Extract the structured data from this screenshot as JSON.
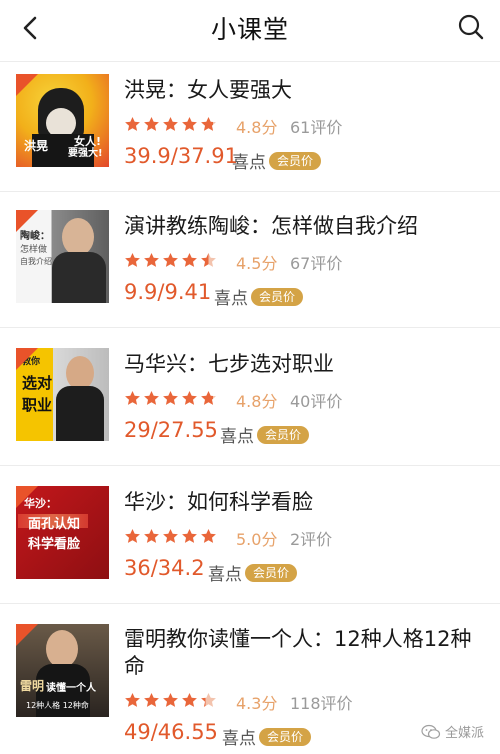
{
  "header": {
    "title": "小课堂",
    "back_icon": "chevron-left-icon",
    "search_icon": "search-icon"
  },
  "courses": [
    {
      "title": "洪晃：女人要强大",
      "rating": 4.8,
      "score_text": "4.8分",
      "reviews_text": "61评价",
      "price_text": "39.9/37.91",
      "xidian_label": "喜点",
      "vip_label": "会员价",
      "cover_label_1": "女人!",
      "cover_label_2": "要强大!",
      "cover_name": "洪晃",
      "cover_colors": [
        "#f2c21a",
        "#e3472b"
      ]
    },
    {
      "title": "演讲教练陶峻：怎样做自我介绍",
      "rating": 4.5,
      "score_text": "4.5分",
      "reviews_text": "67评价",
      "price_text": "9.9/9.41",
      "xidian_label": "喜点",
      "vip_label": "会员价",
      "cover_label_1": "陶峻：",
      "cover_label_2": "怎样做",
      "cover_label_3": "自我介绍",
      "cover_colors": [
        "#efefef",
        "#6b6b6b"
      ]
    },
    {
      "title": "马华兴：七步选对职业",
      "rating": 4.8,
      "score_text": "4.8分",
      "reviews_text": "40评价",
      "price_text": "29/27.55",
      "xidian_label": "喜点",
      "vip_label": "会员价",
      "cover_label_1": "教你",
      "cover_label_2": "选对",
      "cover_label_3": "职业",
      "cover_colors": [
        "#f5c400",
        "#1e1e1e"
      ]
    },
    {
      "title": "华沙：如何科学看脸",
      "rating": 5.0,
      "score_text": "5.0分",
      "reviews_text": "2评价",
      "price_text": "36/34.2",
      "xidian_label": "喜点",
      "vip_label": "会员价",
      "cover_label_1": "华沙：",
      "cover_label_2": "面孔认知",
      "cover_label_3": "科学看脸",
      "cover_colors": [
        "#b0181b",
        "#6e0c0e"
      ]
    },
    {
      "title": "雷明教你读懂一个人：12种人格12种命",
      "rating": 4.3,
      "score_text": "4.3分",
      "reviews_text": "118评价",
      "price_text": "49/46.55",
      "xidian_label": "喜点",
      "vip_label": "会员价",
      "cover_label_1": "雷明",
      "cover_label_2": "读懂一个人",
      "cover_label_3": "12种人格 12种命",
      "cover_colors": [
        "#5a4a3a",
        "#1c1c1c"
      ]
    }
  ],
  "watermark": {
    "text": "全媒派",
    "icon": "wechat-icon"
  }
}
